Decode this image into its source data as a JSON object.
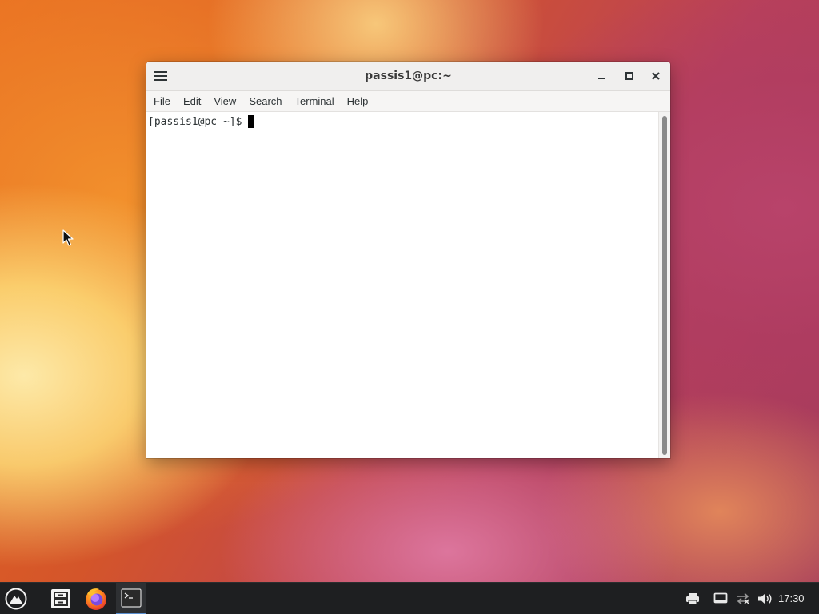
{
  "window": {
    "title": "passis1@pc:~"
  },
  "menu": {
    "items": [
      "File",
      "Edit",
      "View",
      "Search",
      "Terminal",
      "Help"
    ]
  },
  "terminal": {
    "prompt": "[passis1@pc ~]$"
  },
  "taskbar": {
    "clock": "17:30",
    "apps": [
      "start-menu",
      "file-manager",
      "firefox",
      "terminal"
    ],
    "tray_icons": [
      "printer-icon",
      "display-icon",
      "network-icon",
      "volume-icon"
    ]
  },
  "colors": {
    "taskbar_bg": "#1e1f21",
    "active_task_underline": "#5a8fd0",
    "titlebar_bg": "#f0efee"
  }
}
